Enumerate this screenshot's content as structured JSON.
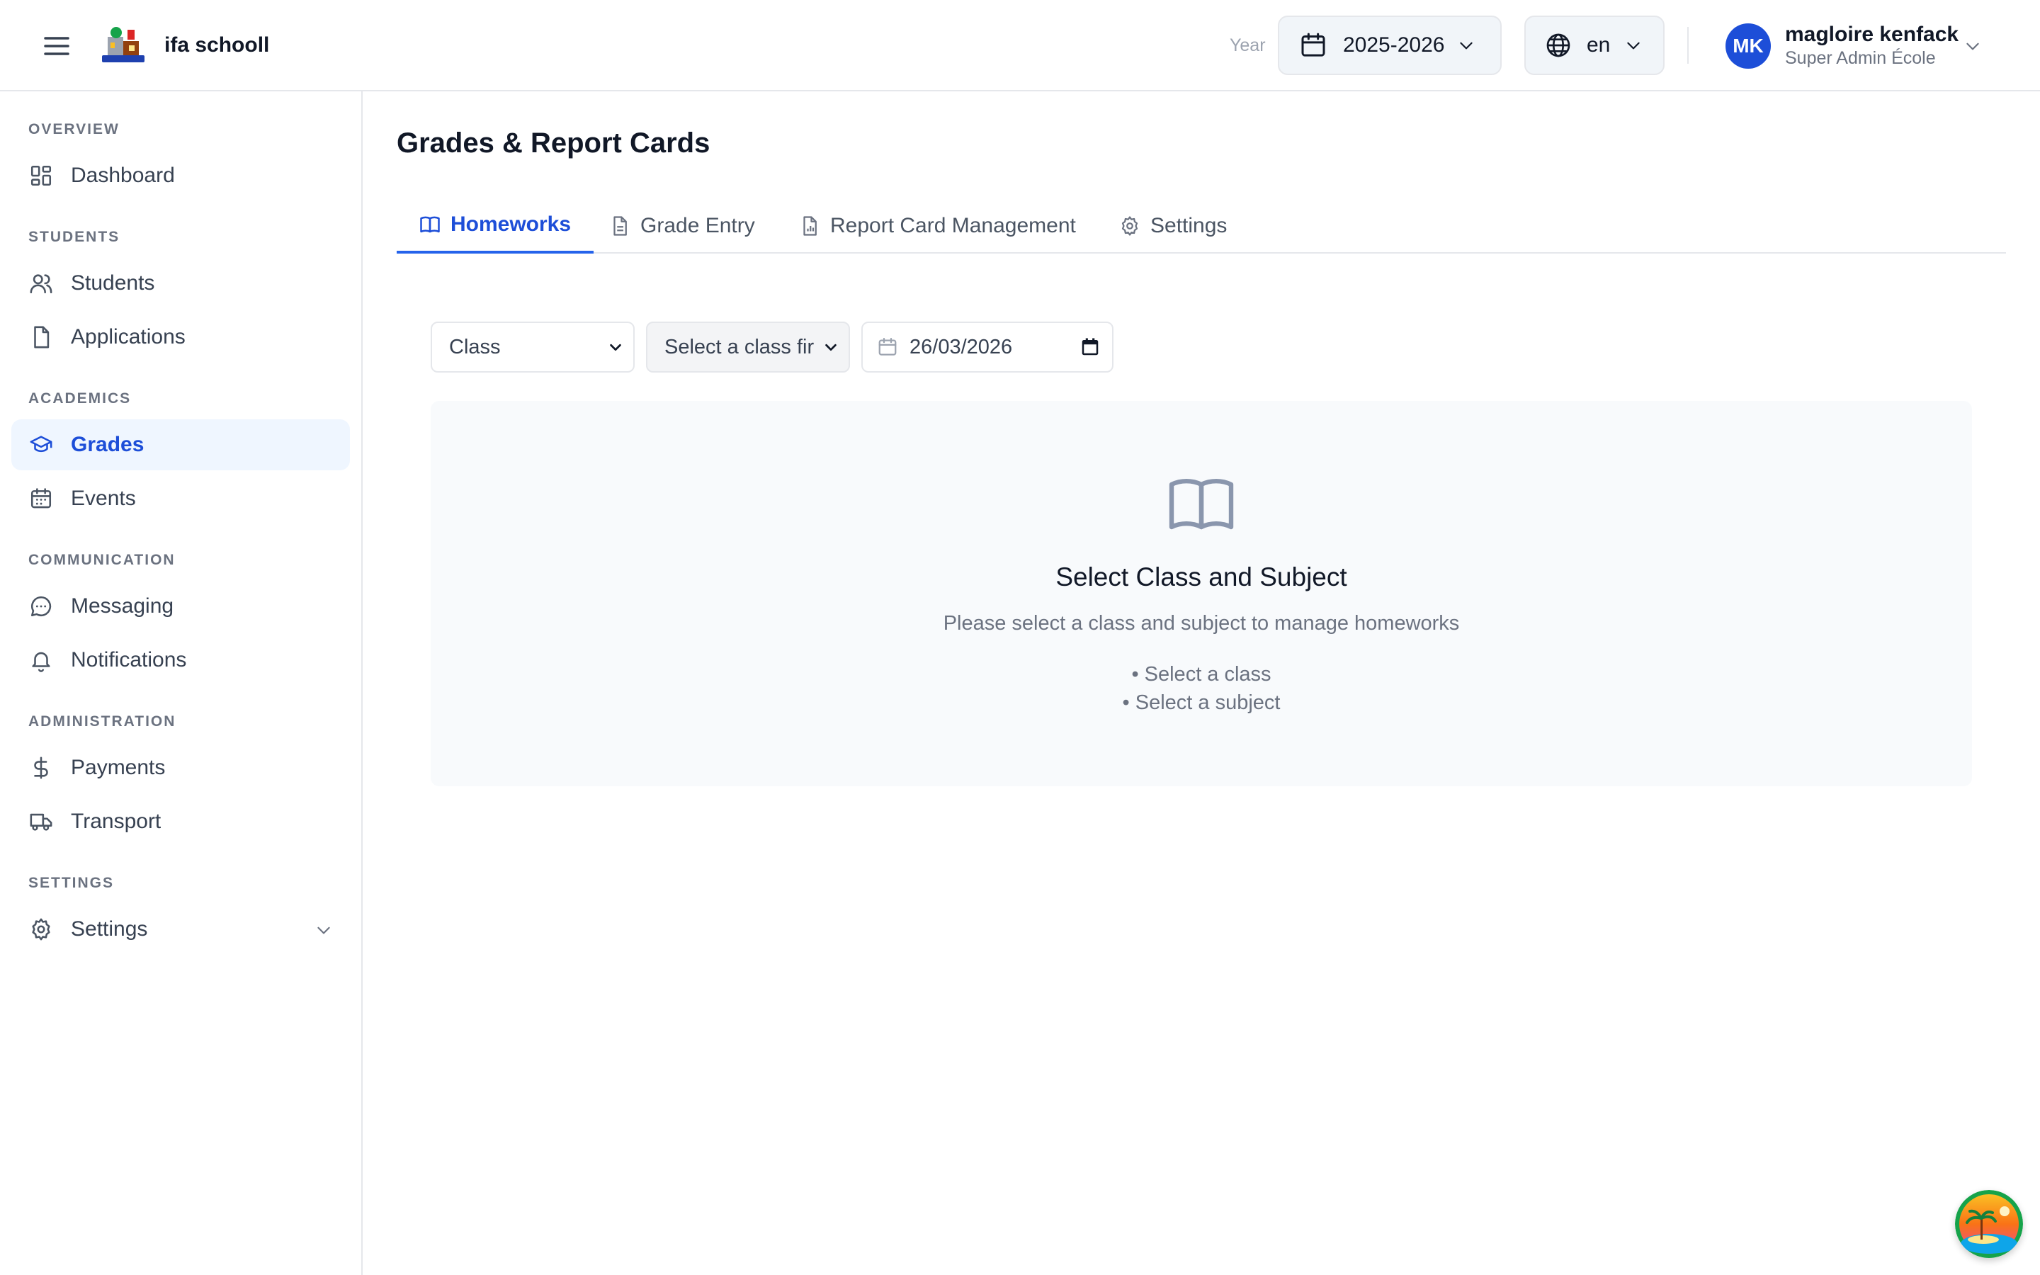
{
  "header": {
    "app_name": "ifa schooll",
    "year_label": "Year",
    "year_value": "2025-2026",
    "language_value": "en",
    "user": {
      "initials": "MK",
      "name": "magloire kenfack",
      "role": "Super Admin École"
    }
  },
  "sidebar": {
    "sections": [
      {
        "label": "OVERVIEW",
        "items": [
          {
            "label": "Dashboard",
            "icon": "dashboard-icon"
          }
        ]
      },
      {
        "label": "STUDENTS",
        "items": [
          {
            "label": "Students",
            "icon": "users-icon"
          },
          {
            "label": "Applications",
            "icon": "file-icon"
          }
        ]
      },
      {
        "label": "ACADEMICS",
        "items": [
          {
            "label": "Grades",
            "icon": "graduation-cap-icon",
            "active": true
          },
          {
            "label": "Events",
            "icon": "calendar-icon"
          }
        ]
      },
      {
        "label": "COMMUNICATION",
        "items": [
          {
            "label": "Messaging",
            "icon": "message-icon"
          },
          {
            "label": "Notifications",
            "icon": "bell-icon"
          }
        ]
      },
      {
        "label": "ADMINISTRATION",
        "items": [
          {
            "label": "Payments",
            "icon": "dollar-icon"
          },
          {
            "label": "Transport",
            "icon": "truck-icon"
          }
        ]
      },
      {
        "label": "SETTINGS",
        "items": [
          {
            "label": "Settings",
            "icon": "gear-icon"
          }
        ]
      }
    ]
  },
  "main": {
    "title": "Grades & Report Cards",
    "tabs": [
      {
        "label": "Homeworks",
        "icon": "book-icon",
        "active": true
      },
      {
        "label": "Grade Entry",
        "icon": "document-icon"
      },
      {
        "label": "Report Card Management",
        "icon": "report-icon"
      },
      {
        "label": "Settings",
        "icon": "gear-icon"
      }
    ],
    "filters": {
      "class_value": "Class",
      "subject_value": "Select a class fir",
      "date_value": "26/03/2026"
    },
    "empty_state": {
      "title": "Select Class and Subject",
      "description": "Please select a class and subject to manage homeworks",
      "hints": [
        "• Select a class",
        "• Select a subject"
      ]
    }
  },
  "colors": {
    "accent": "#1d4ed8",
    "active_bg": "#eff6ff",
    "panel_bg": "#f8fafc"
  }
}
